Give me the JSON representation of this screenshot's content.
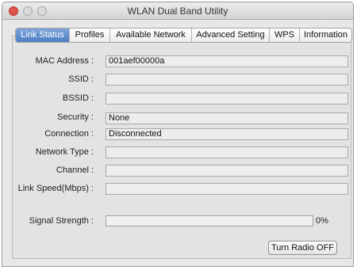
{
  "window": {
    "title": "WLAN Dual Band Utility"
  },
  "tabs": [
    {
      "label": "Link Status",
      "active": true
    },
    {
      "label": "Profiles"
    },
    {
      "label": "Available Network"
    },
    {
      "label": "Advanced Setting"
    },
    {
      "label": "WPS"
    },
    {
      "label": "Information"
    }
  ],
  "link_status": {
    "mac_label": "MAC Address :",
    "mac_value": "001aef00000a",
    "ssid_label": "SSID :",
    "ssid_value": "",
    "bssid_label": "BSSID :",
    "bssid_value": "",
    "security_label": "Security :",
    "security_value": "None",
    "connection_label": "Connection :",
    "connection_value": "Disconnected",
    "network_type_label": "Network Type :",
    "network_type_value": "",
    "channel_label": "Channel :",
    "channel_value": "",
    "link_speed_label": "Link Speed(Mbps) :",
    "link_speed_value": "",
    "signal_label": "Signal Strength :",
    "signal_percent": "0%",
    "signal_fraction": 0
  },
  "buttons": {
    "radio_toggle": "Turn Radio OFF"
  },
  "colors": {
    "close": "#e0524b",
    "active_tab": "#4d7fc4"
  }
}
